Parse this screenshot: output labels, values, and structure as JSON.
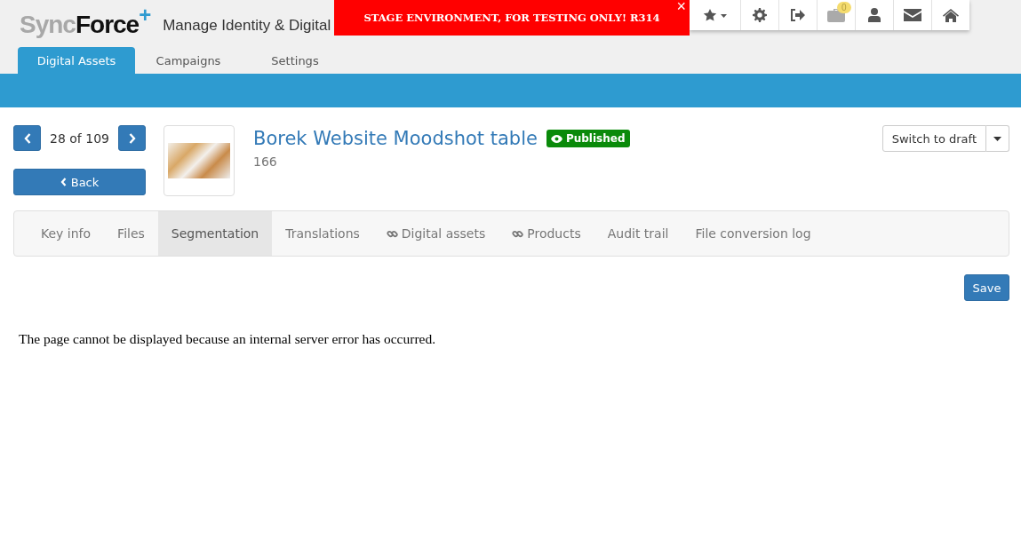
{
  "header": {
    "logo_light": "Sync",
    "logo_bold": "Force",
    "logo_plus": "+",
    "app_title": "Manage Identity & Digital"
  },
  "banner": {
    "text": "STAGE ENVIRONMENT, FOR TESTING ONLY! R314",
    "close": "×"
  },
  "toolbar": {
    "badge": "0"
  },
  "main_tabs": [
    {
      "label": "Digital Assets",
      "selected": true
    },
    {
      "label": "Campaigns",
      "selected": false
    },
    {
      "label": "Settings",
      "selected": false
    }
  ],
  "pager": {
    "position": "28 of 109",
    "back": "Back"
  },
  "asset": {
    "title": "Borek Website Moodshot table",
    "status": "Published",
    "id": "166"
  },
  "actions": {
    "switch": "Switch to draft",
    "save": "Save"
  },
  "detail_tabs": [
    {
      "label": "Key info",
      "selected": false,
      "linked": false
    },
    {
      "label": "Files",
      "selected": false,
      "linked": false
    },
    {
      "label": "Segmentation",
      "selected": true,
      "linked": false
    },
    {
      "label": "Translations",
      "selected": false,
      "linked": false
    },
    {
      "label": "Digital assets",
      "selected": false,
      "linked": true
    },
    {
      "label": "Products",
      "selected": false,
      "linked": true
    },
    {
      "label": "Audit trail",
      "selected": false,
      "linked": false
    },
    {
      "label": "File conversion log",
      "selected": false,
      "linked": false
    }
  ],
  "error_message": "The page cannot be displayed because an internal server error has occurred."
}
